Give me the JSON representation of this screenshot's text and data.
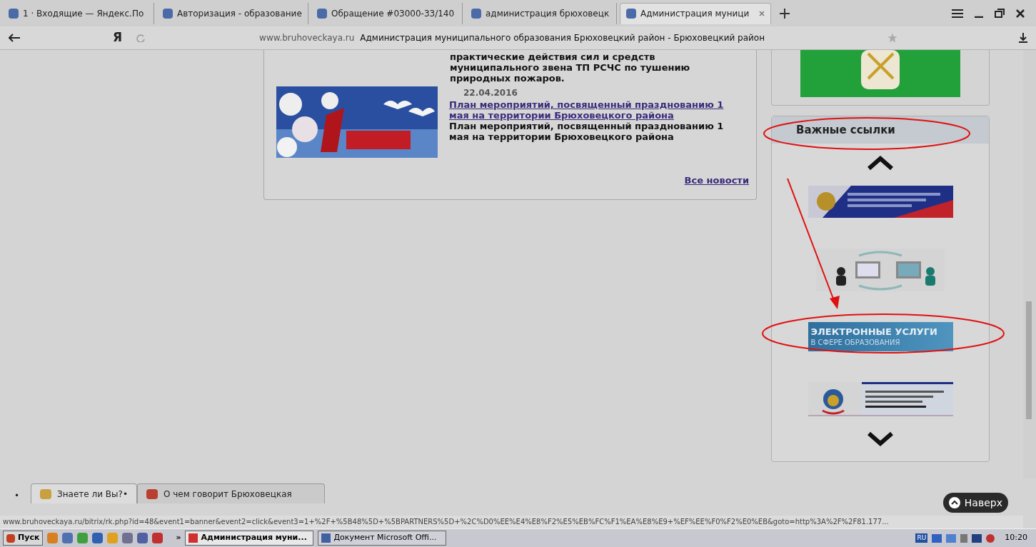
{
  "browser": {
    "tabs": [
      {
        "title": "1 · Входящие — Яндекс.По",
        "selected": false
      },
      {
        "title": "Авторизация - образование",
        "selected": false
      },
      {
        "title": "Обращение #03000-33/140",
        "selected": false
      },
      {
        "title": "администрация брюховецк",
        "selected": false
      },
      {
        "title": "Администрация муници",
        "selected": true
      }
    ],
    "logo": "Я",
    "domain": "www.bruhoveckaya.ru",
    "page_title": "Администрация муниципального образования Брюховецкий район - Брюховецкий район"
  },
  "news": {
    "text_tail": "практические действия сил и средств муниципального звена ТП РСЧС по тушению природных пожаров.",
    "items": [
      {
        "date": "22.04.2016",
        "link": "План мероприятий, посвященный празднованию 1 мая на территории Брюховецкого района",
        "summary": "План мероприятий, посвященный празднованию 1 мая на территории Брюховецкого района"
      }
    ],
    "all_news": "Все новости"
  },
  "sidebar": {
    "links_title": "Важные ссылки",
    "banners": [
      {
        "kind": "picture"
      },
      {
        "kind": "picture"
      },
      {
        "kind": "text",
        "title": "ЭЛЕКТРОННЫЕ УСЛУГИ",
        "subtitle": "В СФЕРЕ ОБРАЗОВАНИЯ"
      },
      {
        "kind": "picture"
      }
    ]
  },
  "bottom": {
    "bullet": "•",
    "tabs": [
      {
        "label": "Знаете ли Вы?•",
        "selected": true
      },
      {
        "label": "О чем говорит Брюховецкая",
        "selected": false
      }
    ],
    "back_to_top": "Наверх"
  },
  "status_url": "www.bruhoveckaya.ru/bitrix/rk.php?id=48&event1=banner&event2=click&event3=1+%2F+%5B48%5D+%5BPARTNERS%5D+%2C%D0%EE%E4%E8%F2%E5%EB%FC%F1%EA%E8%E9+%EF%EE%F0%F2%E0%EB&goto=http%3A%2F%2F81.177...",
  "taskbar": {
    "start": "Пуск",
    "more": "»",
    "tasks": [
      {
        "label": "Администрация муни...",
        "selected": true
      },
      {
        "label": "Документ Microsoft Offi...",
        "selected": false
      }
    ],
    "lang": "RU",
    "clock": "10:20"
  }
}
